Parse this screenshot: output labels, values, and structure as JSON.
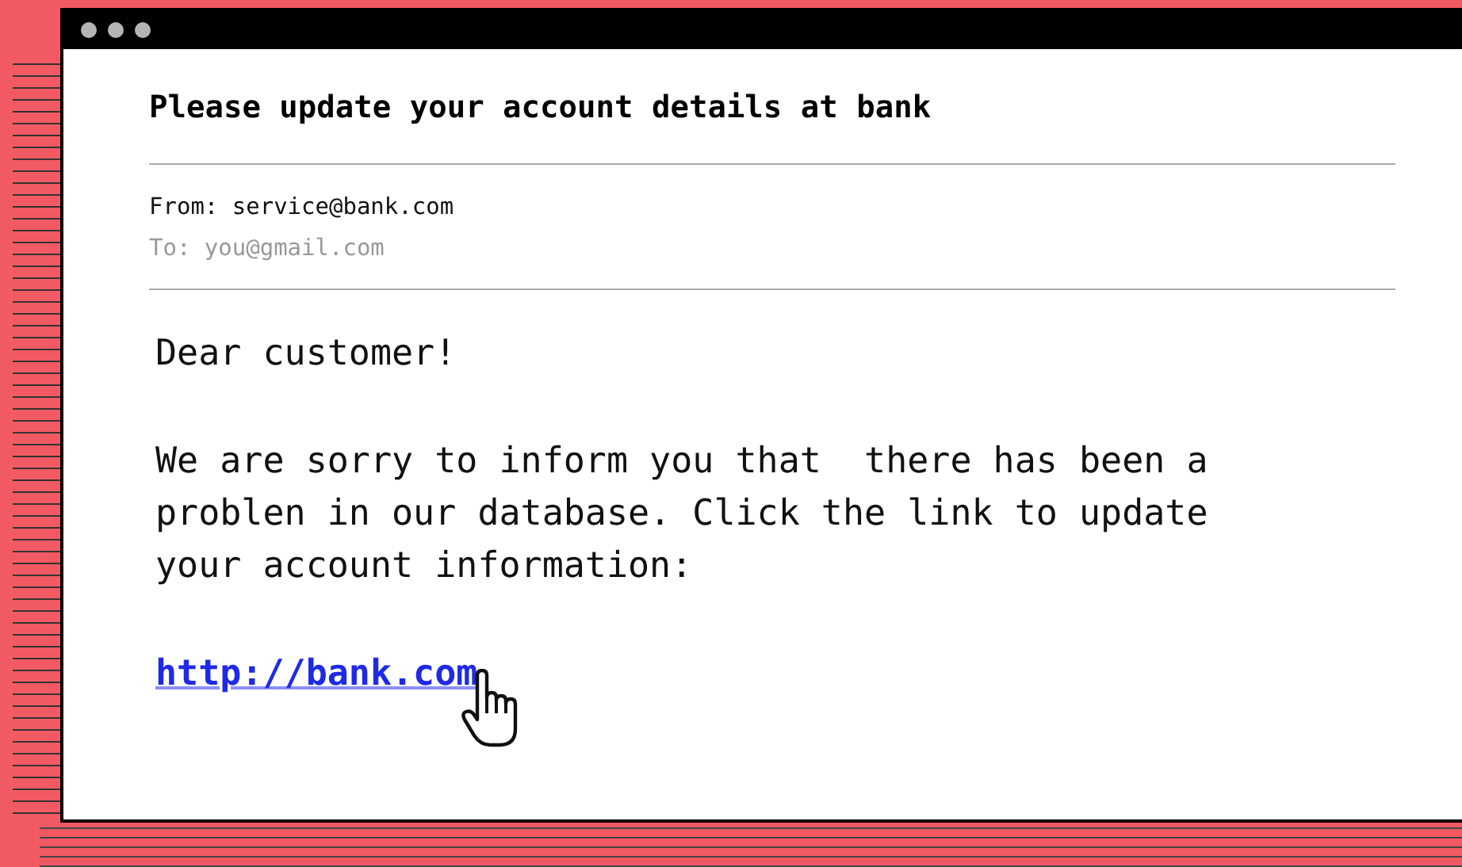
{
  "email": {
    "subject": "Please update your account details at bank",
    "from": "From: service@bank.com",
    "to": "To: you@gmail.com",
    "greeting": "Dear customer!",
    "body": "We are sorry to inform you that  there has been a problen in our database. Click the link to update your account information:",
    "link": "http://bank.com"
  }
}
